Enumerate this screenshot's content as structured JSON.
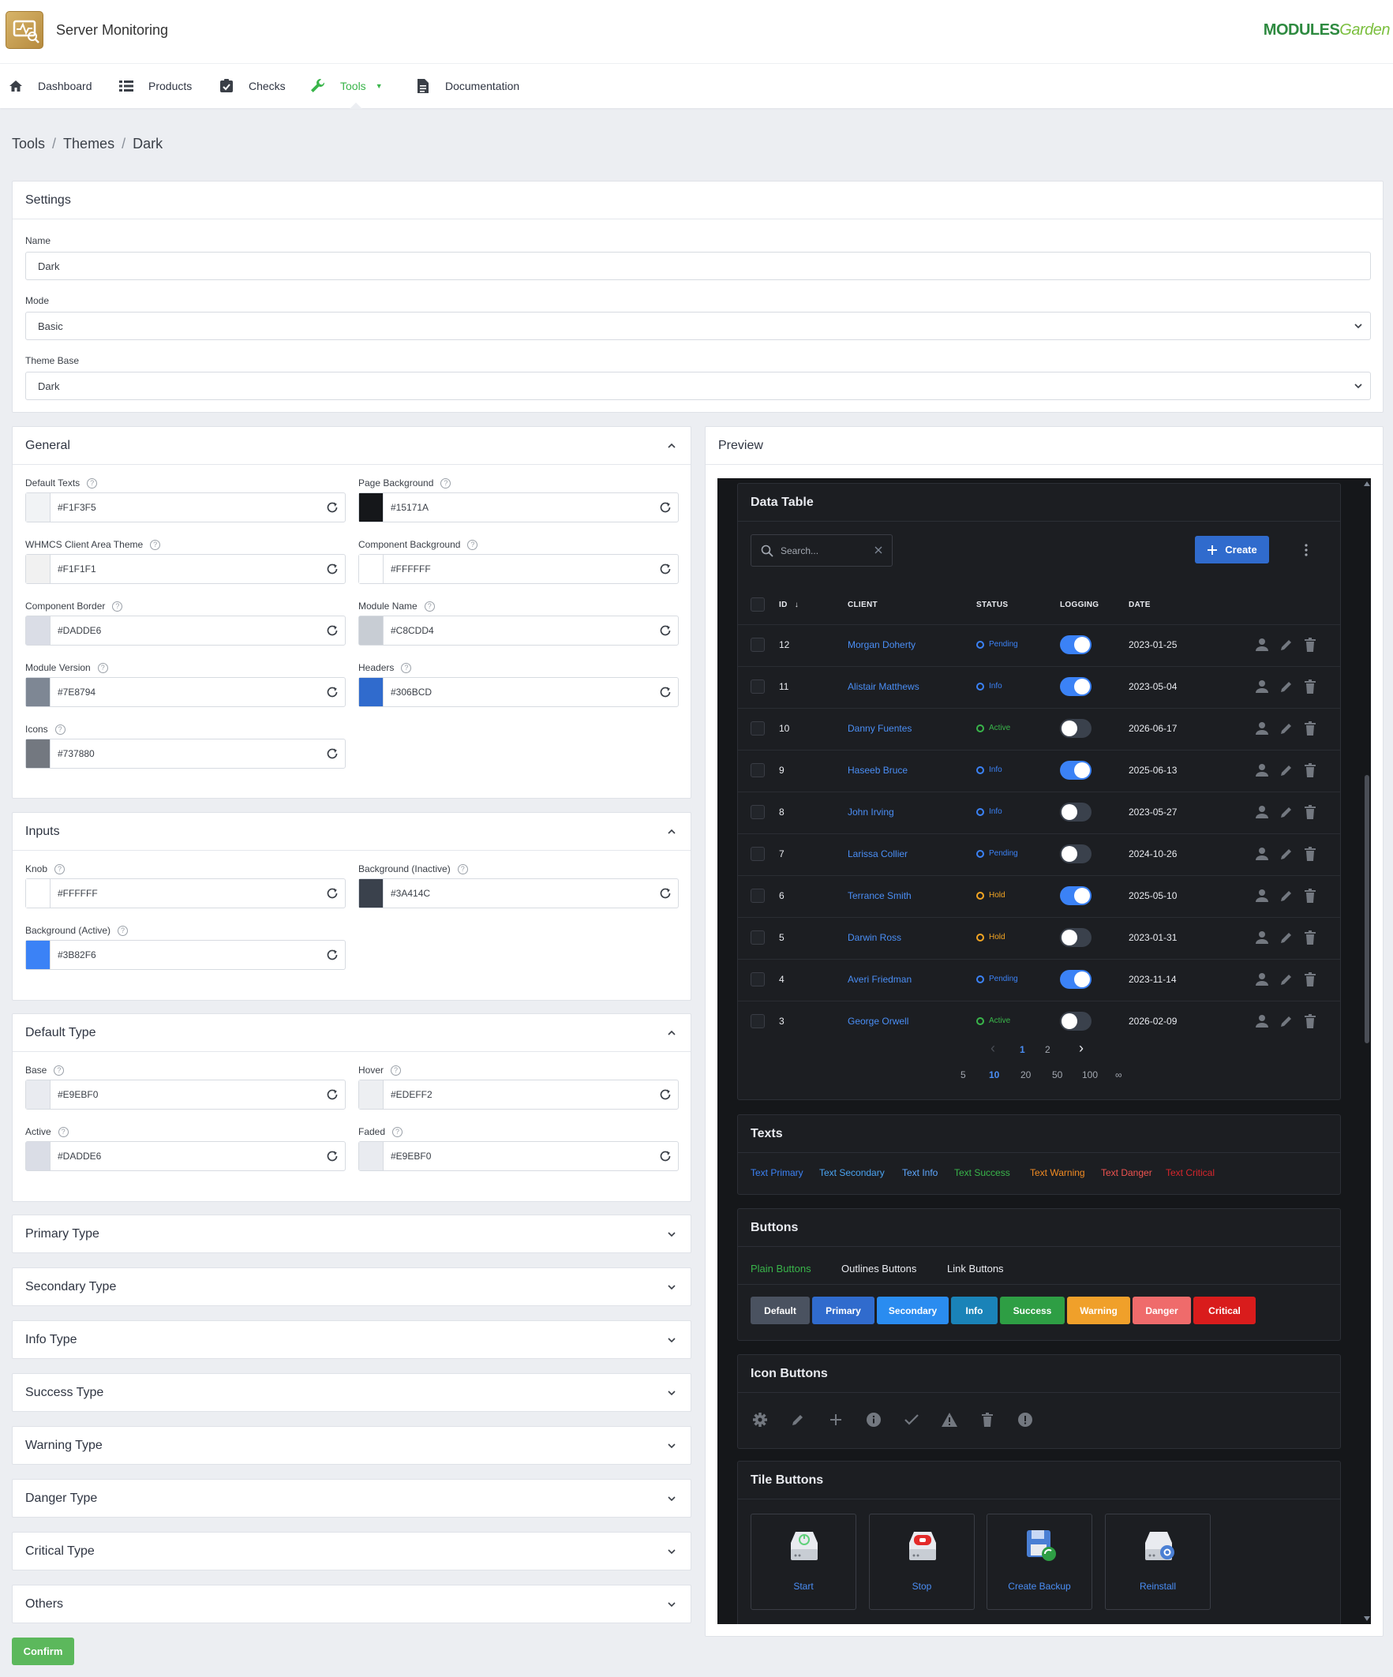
{
  "app": {
    "title": "Server Monitoring",
    "brand_main": "MODULES",
    "brand_sub": "Garden"
  },
  "nav": [
    {
      "label": "Dashboard",
      "icon": "home-icon"
    },
    {
      "label": "Products",
      "icon": "list-icon"
    },
    {
      "label": "Checks",
      "icon": "clipboard-check-icon"
    },
    {
      "label": "Tools",
      "icon": "wrench-icon",
      "active": true
    },
    {
      "label": "Documentation",
      "icon": "document-icon"
    }
  ],
  "breadcrumb": [
    "Tools",
    "Themes",
    "Dark"
  ],
  "settings": {
    "title": "Settings",
    "name_label": "Name",
    "name_value": "Dark",
    "mode_label": "Mode",
    "mode_value": "Basic",
    "base_label": "Theme Base",
    "base_value": "Dark"
  },
  "general": {
    "title": "General",
    "fields": [
      {
        "label": "Default Texts",
        "value": "#F1F3F5",
        "color": "#F1F3F5"
      },
      {
        "label": "Page Background",
        "value": "#15171A",
        "color": "#15171A"
      },
      {
        "label": "WHMCS Client Area Theme",
        "value": "#F1F1F1",
        "color": "#F1F1F1"
      },
      {
        "label": "Component Background",
        "value": "#FFFFFF",
        "color": "#FFFFFF"
      },
      {
        "label": "Component Border",
        "value": "#DADDE6",
        "color": "#DADDE6"
      },
      {
        "label": "Module Name",
        "value": "#C8CDD4",
        "color": "#C8CDD4"
      },
      {
        "label": "Module Version",
        "value": "#7E8794",
        "color": "#7E8794"
      },
      {
        "label": "Headers",
        "value": "#306BCD",
        "color": "#306BCD"
      },
      {
        "label": "Icons",
        "value": "#737880",
        "color": "#737880"
      }
    ]
  },
  "inputs": {
    "title": "Inputs",
    "fields": [
      {
        "label": "Knob",
        "value": "#FFFFFF",
        "color": "#FFFFFF"
      },
      {
        "label": "Background (Inactive)",
        "value": "#3A414C",
        "color": "#3A414C"
      },
      {
        "label": "Background (Active)",
        "value": "#3B82F6",
        "color": "#3B82F6"
      }
    ]
  },
  "default_type": {
    "title": "Default Type",
    "fields": [
      {
        "label": "Base",
        "value": "#E9EBF0",
        "color": "#E9EBF0"
      },
      {
        "label": "Hover",
        "value": "#EDEFF2",
        "color": "#EDEFF2"
      },
      {
        "label": "Active",
        "value": "#DADDE6",
        "color": "#DADDE6"
      },
      {
        "label": "Faded",
        "value": "#E9EBF0",
        "color": "#E9EBF0"
      }
    ]
  },
  "collapsed_sections": [
    "Primary Type",
    "Secondary Type",
    "Info Type",
    "Success Type",
    "Warning Type",
    "Danger Type",
    "Critical Type",
    "Others"
  ],
  "confirm_label": "Confirm",
  "preview": {
    "title": "Preview",
    "data_table": {
      "title": "Data Table",
      "search_placeholder": "Search...",
      "create_label": "Create",
      "columns": [
        "ID",
        "CLIENT",
        "STATUS",
        "LOGGING",
        "DATE"
      ],
      "rows": [
        {
          "id": "12",
          "client": "Morgan Doherty",
          "status": "Pending",
          "logging": true,
          "date": "2023-01-25"
        },
        {
          "id": "11",
          "client": "Alistair Matthews",
          "status": "Info",
          "logging": true,
          "date": "2023-05-04"
        },
        {
          "id": "10",
          "client": "Danny Fuentes",
          "status": "Active",
          "logging": false,
          "date": "2026-06-17"
        },
        {
          "id": "9",
          "client": "Haseeb Bruce",
          "status": "Info",
          "logging": true,
          "date": "2025-06-13"
        },
        {
          "id": "8",
          "client": "John Irving",
          "status": "Info",
          "logging": false,
          "date": "2023-05-27"
        },
        {
          "id": "7",
          "client": "Larissa Collier",
          "status": "Pending",
          "logging": false,
          "date": "2024-10-26"
        },
        {
          "id": "6",
          "client": "Terrance Smith",
          "status": "Hold",
          "logging": true,
          "date": "2025-05-10"
        },
        {
          "id": "5",
          "client": "Darwin Ross",
          "status": "Hold",
          "logging": false,
          "date": "2023-01-31"
        },
        {
          "id": "4",
          "client": "Averi Friedman",
          "status": "Pending",
          "logging": true,
          "date": "2023-11-14"
        },
        {
          "id": "3",
          "client": "George Orwell",
          "status": "Active",
          "logging": false,
          "date": "2026-02-09"
        }
      ],
      "pages": [
        "1",
        "2"
      ],
      "page_sizes": [
        "5",
        "10",
        "20",
        "50",
        "100",
        "∞"
      ],
      "status_colors": {
        "Pending": "#3b82f6",
        "Info": "#3b82f6",
        "Active": "#39b54a",
        "Hold": "#f5a623"
      },
      "toggle_on": "#3B82F6",
      "toggle_off": "#3A414C"
    },
    "texts": {
      "title": "Texts",
      "items": [
        {
          "label": "Text Primary",
          "color": "#3b82f6"
        },
        {
          "label": "Text Secondary",
          "color": "#4aa3f0"
        },
        {
          "label": "Text Info",
          "color": "#5fa8ff"
        },
        {
          "label": "Text Success",
          "color": "#39b54a"
        },
        {
          "label": "Text Warning",
          "color": "#f28b22"
        },
        {
          "label": "Text Danger",
          "color": "#ef5350"
        },
        {
          "label": "Text Critical",
          "color": "#d9262c"
        }
      ]
    },
    "buttons": {
      "title": "Buttons",
      "tabs": [
        "Plain Buttons",
        "Outlines Buttons",
        "Link Buttons"
      ],
      "items": [
        {
          "label": "Default",
          "color": "#4a5260"
        },
        {
          "label": "Primary",
          "color": "#306bcd"
        },
        {
          "label": "Secondary",
          "color": "#2a8cf0"
        },
        {
          "label": "Info",
          "color": "#1a83b8"
        },
        {
          "label": "Success",
          "color": "#2e9e44"
        },
        {
          "label": "Warning",
          "color": "#f0a02a"
        },
        {
          "label": "Danger",
          "color": "#ef6b6b"
        },
        {
          "label": "Critical",
          "color": "#d91c1c"
        }
      ]
    },
    "icon_buttons": {
      "title": "Icon Buttons",
      "icons": [
        "gear-icon",
        "pencil-icon",
        "plus-icon",
        "info-icon",
        "check-icon",
        "warning-icon",
        "trash-icon",
        "alert-icon"
      ]
    },
    "tile_buttons": {
      "title": "Tile Buttons",
      "items": [
        "Start",
        "Stop",
        "Create Backup",
        "Reinstall"
      ]
    }
  }
}
